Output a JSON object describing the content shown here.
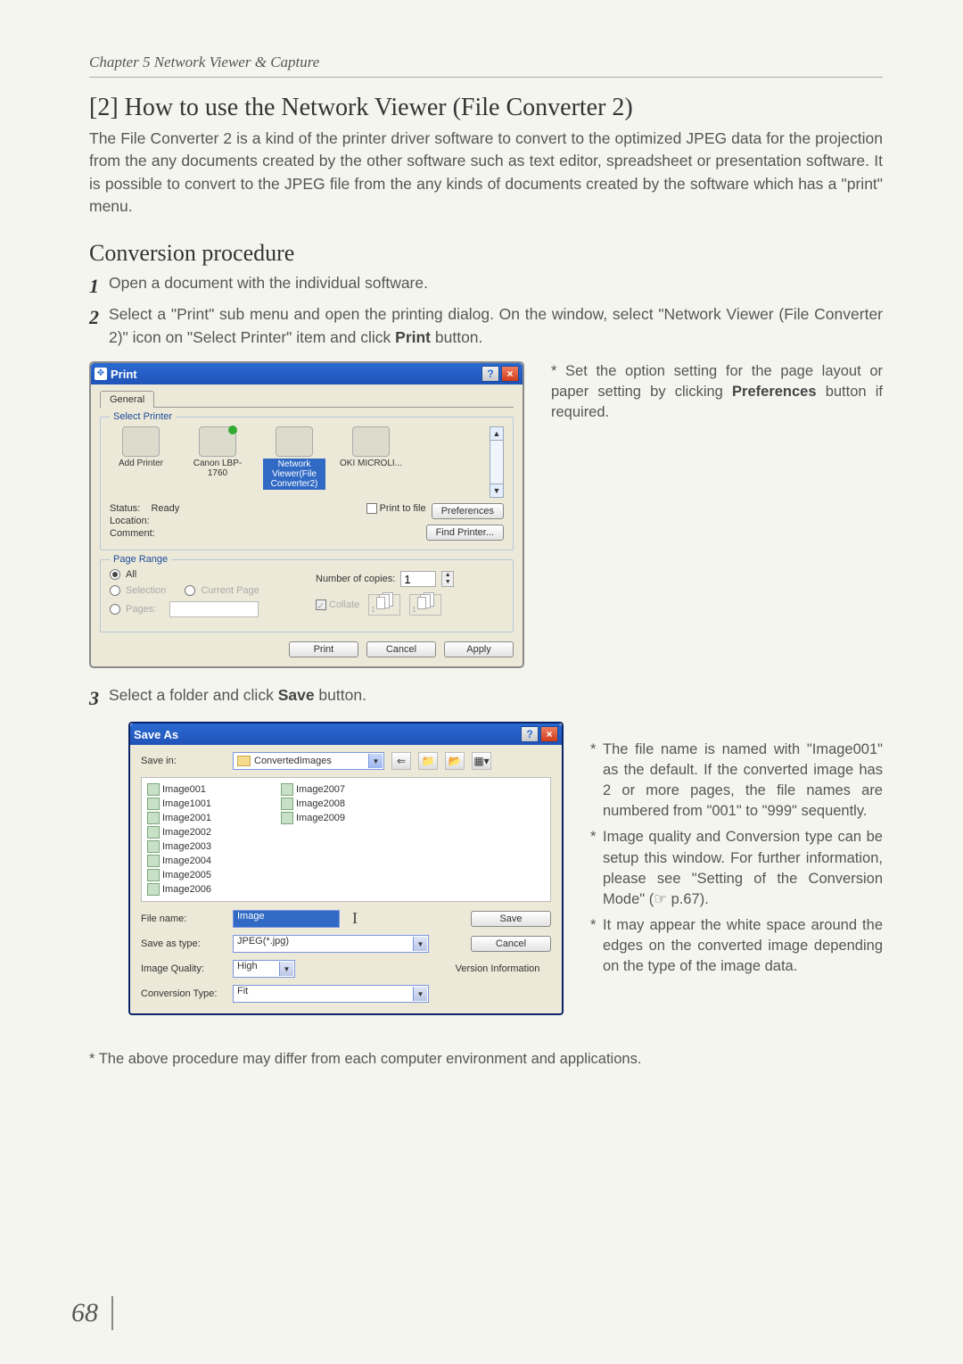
{
  "chapter_header": "Chapter 5 Network Viewer & Capture",
  "section_title": "[2] How to use the Network Viewer (File Converter 2)",
  "intro": "The File Converter 2 is a kind of the printer driver software to convert to the optimized JPEG data for the projection from the any documents created by the other software such as text editor, spreadsheet or presentation software. It is possible to convert to the JPEG file from the any kinds of documents created by the software which has a \"print\" menu.",
  "sub_title": "Conversion procedure",
  "steps": {
    "s1": {
      "num": "1",
      "text": "Open a document with the individual software."
    },
    "s2": {
      "num": "2",
      "pre": "Select a \"Print\" sub menu and open the printing dialog. On the window, select \"Network Viewer (File Converter 2)\" icon on \"Select Printer\" item and click ",
      "bold": "Print",
      "post": " button."
    },
    "s3": {
      "num": "3",
      "pre": "Select a folder and click ",
      "bold": "Save",
      "post": " button."
    }
  },
  "right_note_top": {
    "pre": "* Set the option setting for the page layout or paper setting by clicking ",
    "bold": "Preferences",
    "post": " button if required."
  },
  "print_dialog": {
    "title": "Print",
    "tab": "General",
    "legend_printer": "Select Printer",
    "printers": {
      "p0": "Add Printer",
      "p1": "Canon LBP-1760",
      "p2": "Network Viewer(File Converter2)",
      "p3": "OKI MICROLI..."
    },
    "status_lbl": "Status:",
    "status_val": "Ready",
    "location_lbl": "Location:",
    "comment_lbl": "Comment:",
    "print_to_file": "Print to file",
    "pref_btn": "Preferences",
    "find_btn": "Find Printer...",
    "legend_range": "Page Range",
    "opt_all": "All",
    "opt_sel": "Selection",
    "opt_cur": "Current Page",
    "opt_pages": "Pages:",
    "num_copies_lbl": "Number of copies:",
    "num_copies_val": "1",
    "collate_lbl": "Collate",
    "btn_print": "Print",
    "btn_cancel": "Cancel",
    "btn_apply": "Apply"
  },
  "save_dialog": {
    "title": "Save As",
    "save_in_lbl": "Save in:",
    "folder": "ConvertedImages",
    "files": [
      "Image001",
      "Image1001",
      "Image2001",
      "Image2002",
      "Image2003",
      "Image2004",
      "Image2005",
      "Image2006",
      "Image2007",
      "Image2008",
      "Image2009"
    ],
    "file_name_lbl": "File name:",
    "file_name_val": "Image",
    "save_as_type_lbl": "Save as type:",
    "save_as_type_val": "JPEG(*.jpg)",
    "image_quality_lbl": "Image Quality:",
    "image_quality_val": "High",
    "conversion_type_lbl": "Conversion Type:",
    "conversion_type_val": "Fit",
    "btn_save": "Save",
    "btn_cancel": "Cancel",
    "btn_version": "Version Information"
  },
  "right_notes_bottom": {
    "n1": "The file name is named with \"Image001\" as the default. If the converted image has 2 or more pages, the file names are numbered from \"001\" to \"999\" sequently.",
    "n2": "Image quality and Conversion type can be setup this window. For further information, please see \"Setting of the Conversion Mode\" (☞ p.67).",
    "n3": "It may appear the white space around the edges on the converted image depending on the type of the image data."
  },
  "bottom_note": "* The above procedure may differ from each computer environment and applications.",
  "page_number": "68"
}
